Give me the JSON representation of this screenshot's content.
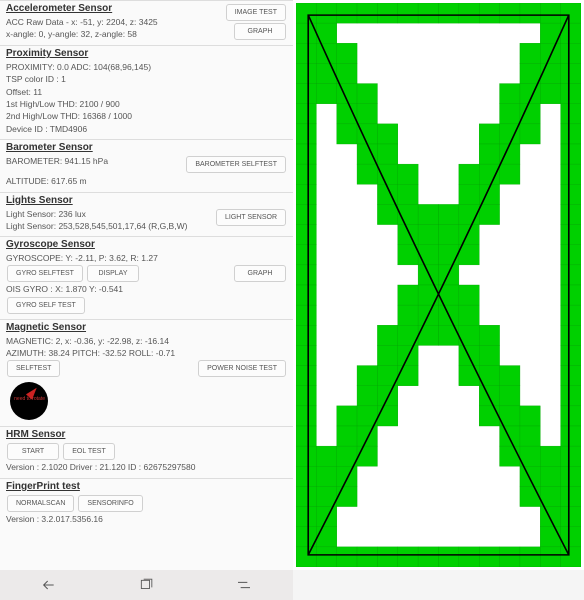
{
  "accel": {
    "title": "Accelerometer Sensor",
    "raw": "ACC Raw Data - x: -51, y: 2204, z: 3425",
    "angle": "x-angle: 0, y-angle: 32, z-angle: 58",
    "btn_image": "Image Test",
    "btn_graph": "Graph"
  },
  "prox": {
    "title": "Proximity Sensor",
    "line1": "PROXIMITY: 0.0      ADC: 104(68,96,145)",
    "tsp": "TSP color ID : 1",
    "offset": "Offset: 11",
    "thd1": "1st High/Low THD: 2100 / 900",
    "thd2": "2nd High/Low THD: 16368 / 1000",
    "device": "Device ID : TMD4906"
  },
  "baro": {
    "title": "Barometer Sensor",
    "pressure": "BAROMETER: 941.15 hPa",
    "alt": "ALTITUDE: 617.65 m",
    "btn": "Barometer Selftest"
  },
  "light": {
    "title": "Lights Sensor",
    "lux": "Light Sensor: 236 lux",
    "rgbw": "Light Sensor: 253,528,545,501,17,64 (R,G,B,W)",
    "btn": "Light Sensor"
  },
  "gyro": {
    "title": "Gyroscope Sensor",
    "data": "GYROSCOPE: Y: -2.11, P: 3.62, R: 1.27",
    "btn_selftest": "Gyro Selftest",
    "btn_display": "Display",
    "btn_graph": "Graph",
    "ois": "OIS GYRO : X: 1.870 Y: -0.541",
    "btn_ois": "Gyro Self Test"
  },
  "mag": {
    "title": "Magnetic Sensor",
    "data": "MAGNETIC: 2, x: -0.36, y: -22.98, z: -16.14",
    "azimuth": "AZIMUTH: 38.24    PITCH: -32.52    ROLL: -0.71",
    "btn_selftest": "Selftest",
    "btn_power": "Power Noise Test",
    "compass_text": "need to rotate"
  },
  "hrm": {
    "title": "HRM Sensor",
    "btn_start": "Start",
    "btn_eol": "EOL Test",
    "version": "Version : 2.1020    Driver : 21.120    ID : 62675297580"
  },
  "fp": {
    "title": "FingerPrint test",
    "btn_normal": "Normalscan",
    "btn_sensor": "Sensorinfo",
    "version": "Version : 3.2.017.5356.16"
  },
  "touch_test": {
    "grid_color": "#00d000",
    "line_color": "#000000",
    "grid_cols": 14,
    "grid_rows": 28
  }
}
